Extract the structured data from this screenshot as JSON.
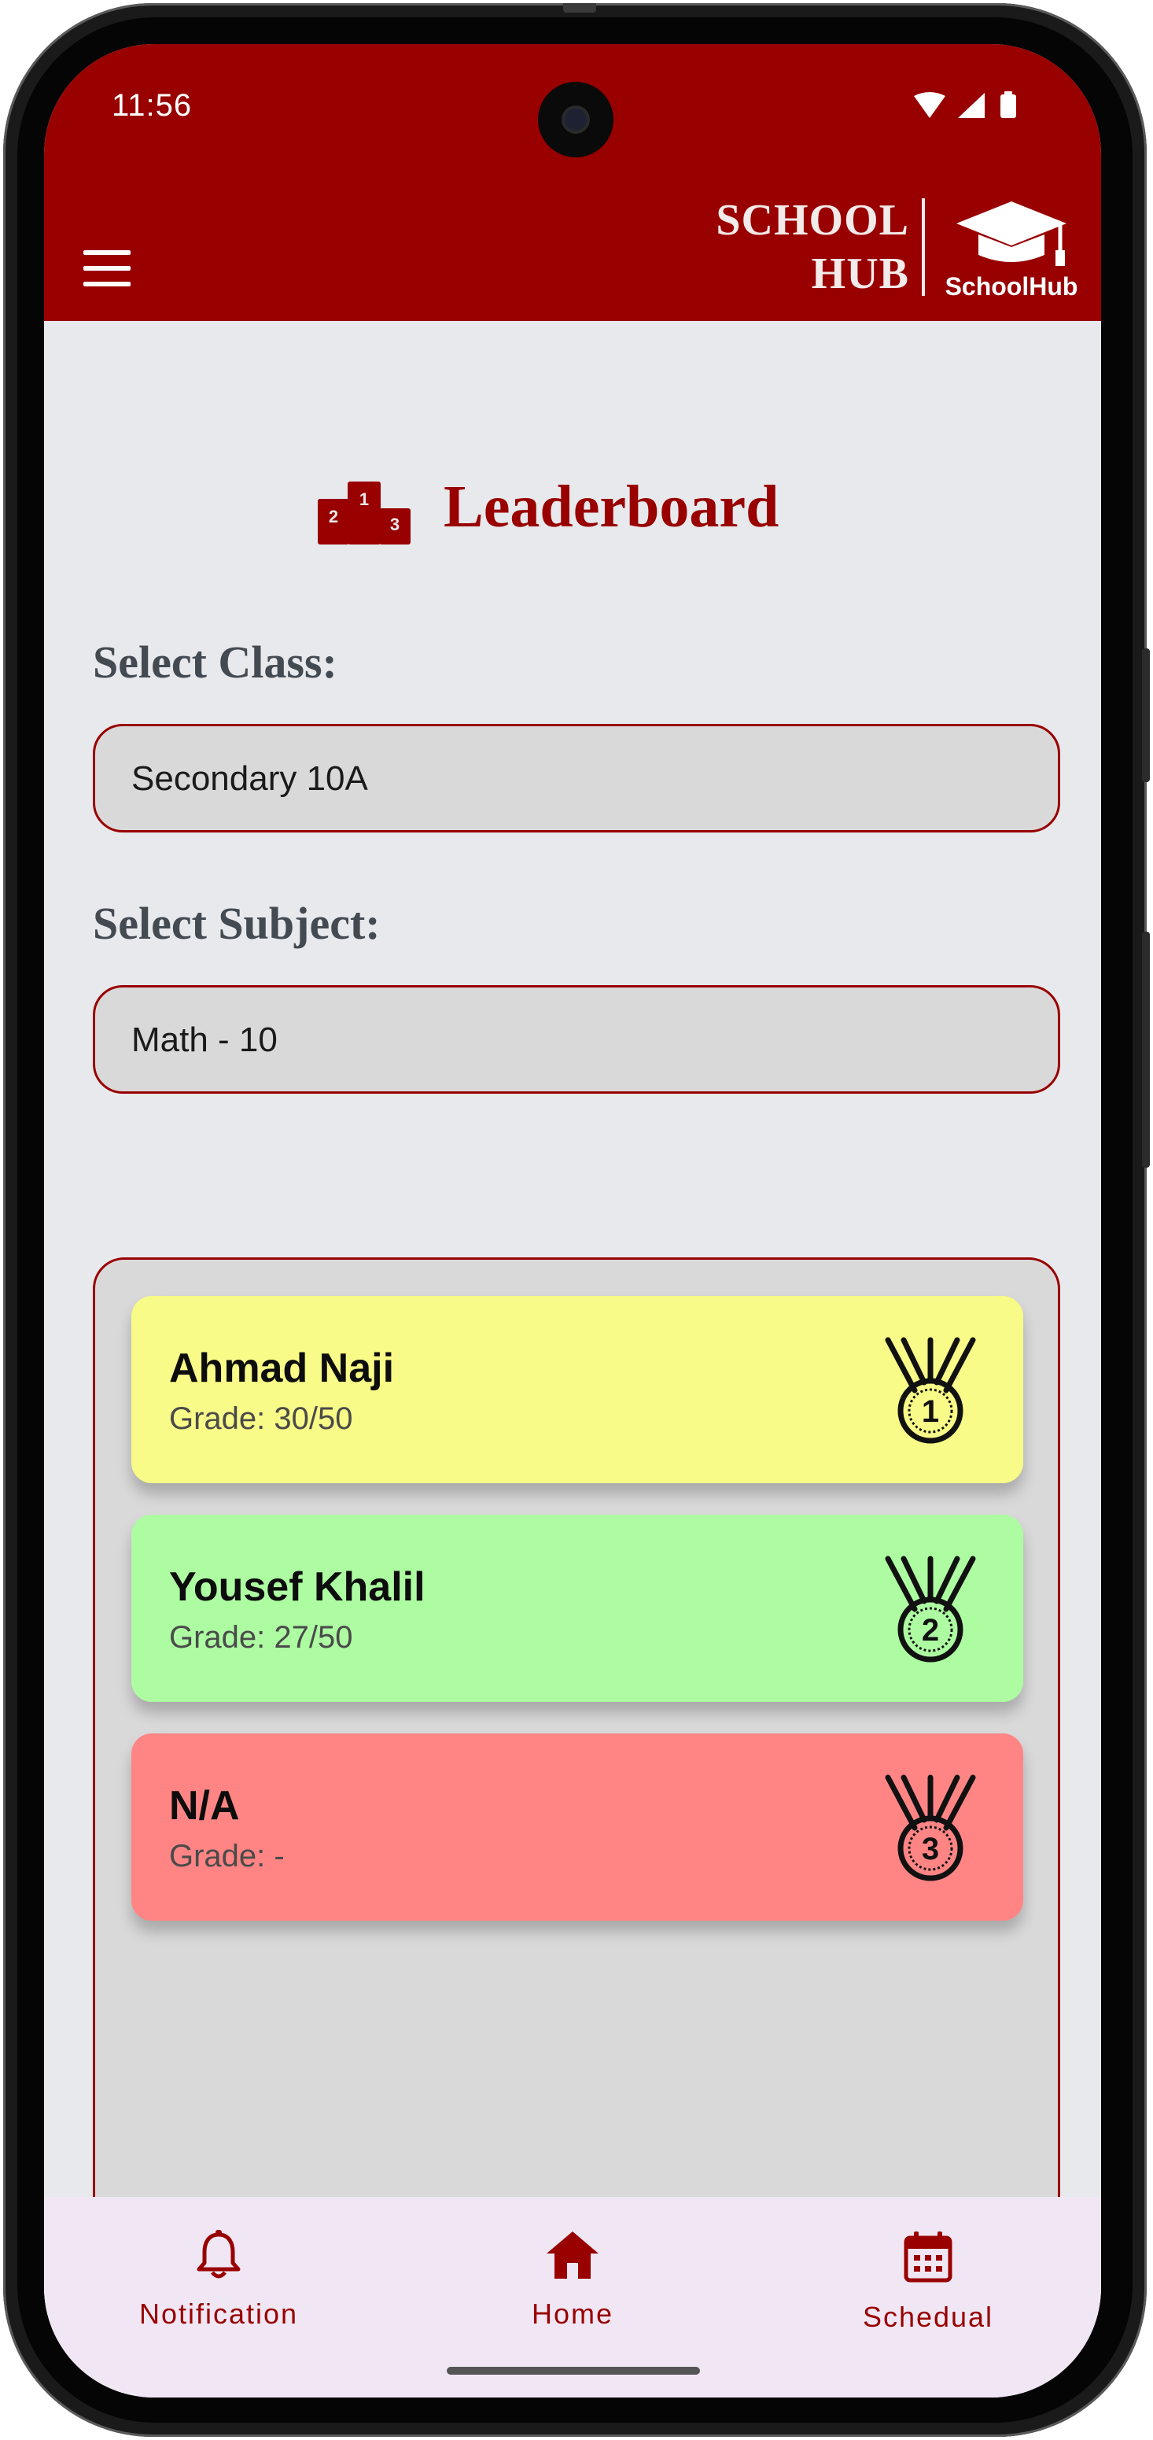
{
  "status_bar": {
    "time": "11:56"
  },
  "header": {
    "brand_line1": "SCHOOL",
    "brand_line2": "HUB",
    "logo_caption": "SchoolHub"
  },
  "page": {
    "title": "Leaderboard"
  },
  "filters": {
    "class_label": "Select Class:",
    "class_value": "Secondary 10A",
    "subject_label": "Select Subject:",
    "subject_value": "Math - 10"
  },
  "leaderboard": [
    {
      "name": "Ahmad Naji",
      "grade": "Grade: 30/50",
      "rank": "1",
      "color": "#f8fb87"
    },
    {
      "name": "Yousef Khalil",
      "grade": "Grade: 27/50",
      "rank": "2",
      "color": "#adfca2"
    },
    {
      "name": "N/A",
      "grade": "Grade: -",
      "rank": "3",
      "color": "#ff8585"
    }
  ],
  "bottom_nav": [
    {
      "label": "Notification",
      "icon": "bell-icon"
    },
    {
      "label": "Home",
      "icon": "home-icon"
    },
    {
      "label": "Schedual",
      "icon": "calendar-icon"
    }
  ],
  "colors": {
    "primary": "#990000",
    "background": "#e7e9ec",
    "nav_background": "#f1e7f4"
  }
}
